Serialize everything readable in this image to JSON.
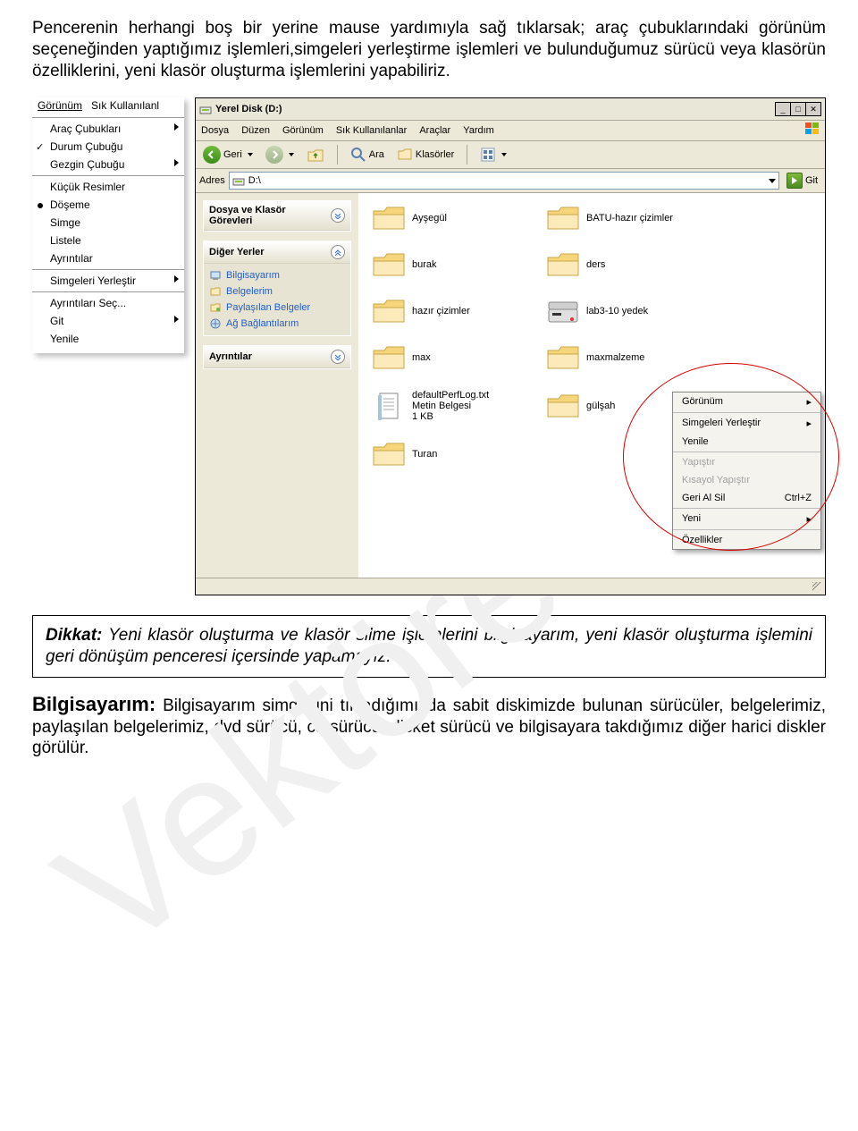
{
  "intro_text": "Pencerenin herhangi boş bir yerine mause yardımıyla sağ tıklarsak; araç çubuklarındaki görünüm seçeneğinden yaptığımız işlemleri,simgeleri yerleştirme işlemleri ve bulunduğumuz sürücü veya klasörün özelliklerini, yeni klasör oluşturma işlemlerini yapabiliriz.",
  "view_menu": {
    "header1": "Görünüm",
    "header2": "Sık Kullanılanl",
    "items": [
      {
        "label": "Araç Çubukları",
        "submenu": true
      },
      {
        "label": "Durum Çubuğu",
        "checked": true
      },
      {
        "label": "Gezgin Çubuğu",
        "submenu": true
      },
      {
        "sep": true
      },
      {
        "label": "Küçük Resimler"
      },
      {
        "label": "Döşeme",
        "radio": true
      },
      {
        "label": "Simge"
      },
      {
        "label": "Listele"
      },
      {
        "label": "Ayrıntılar"
      },
      {
        "sep": true
      },
      {
        "label": "Simgeleri Yerleştir",
        "submenu": true
      },
      {
        "sep": true
      },
      {
        "label": "Ayrıntıları Seç..."
      },
      {
        "label": "Git",
        "submenu": true
      },
      {
        "label": "Yenile"
      }
    ]
  },
  "explorer": {
    "title": "Yerel Disk (D:)",
    "menu": [
      "Dosya",
      "Düzen",
      "Görünüm",
      "Sık Kullanılanlar",
      "Araçlar",
      "Yardım"
    ],
    "toolbar": {
      "back": "Geri",
      "search": "Ara",
      "folders": "Klasörler"
    },
    "address": {
      "label": "Adres",
      "value": "D:\\",
      "go": "Git"
    },
    "tasks": {
      "box1_title": "Dosya ve Klasör Görevleri",
      "box2_title": "Diğer Yerler",
      "box2_items": [
        "Bilgisayarım",
        "Belgelerim",
        "Paylaşılan Belgeler",
        "Ağ Bağlantılarım"
      ],
      "box3_title": "Ayrıntılar"
    },
    "folders": [
      {
        "name": "Ayşegül"
      },
      {
        "name": "BATU-hazır çizimler"
      },
      {
        "name": "burak"
      },
      {
        "name": "ders"
      },
      {
        "name": "hazır çizimler"
      },
      {
        "name": "lab3-10 yedek",
        "special": "drive"
      },
      {
        "name": "max"
      },
      {
        "name": "maxmalzeme"
      },
      {
        "name": "defaultPerfLog.txt",
        "sub1": "Metin Belgesi",
        "sub2": "1 KB",
        "special": "txt"
      },
      {
        "name": "gülşah"
      },
      {
        "name": "Turan"
      }
    ],
    "context": [
      {
        "label": "Görünüm",
        "submenu": true,
        "enabled": true
      },
      {
        "sep": true
      },
      {
        "label": "Simgeleri Yerleştir",
        "submenu": true,
        "enabled": true
      },
      {
        "label": "Yenile",
        "enabled": true
      },
      {
        "sep": true
      },
      {
        "label": "Yapıştır",
        "enabled": false
      },
      {
        "label": "Kısayol Yapıştır",
        "enabled": false
      },
      {
        "label": "Geri Al Sil",
        "shortcut": "Ctrl+Z",
        "enabled": true
      },
      {
        "sep": true
      },
      {
        "label": "Yeni",
        "submenu": true,
        "enabled": true
      },
      {
        "sep": true
      },
      {
        "label": "Özellikler",
        "enabled": true
      }
    ]
  },
  "note": {
    "bold": "Dikkat:",
    "text": " Yeni klasör oluşturma ve klasör silme işlemlerini bilgisayarım, yeni klasör oluşturma işlemini geri dönüşüm penceresi içersinde yapamayız."
  },
  "para": {
    "bold": "Bilgisayarım:",
    "text": " Bilgisayarım simgesini tıkladığımızda sabit diskimizde bulunan sürücüler, belgelerimiz, paylaşılan belgelerimiz, dvd sürücü, cd sürücü, disket sürücü ve bilgisayara takdığımız diğer harici diskler görülür."
  },
  "watermark": "Vektörel"
}
